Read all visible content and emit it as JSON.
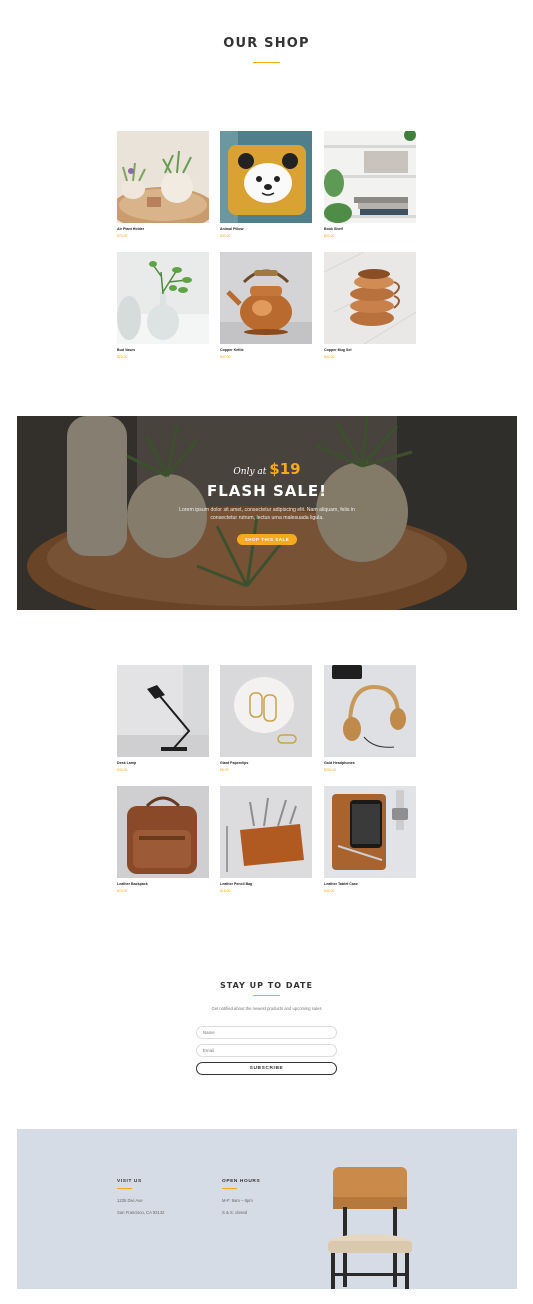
{
  "header": {
    "title": "OUR SHOP"
  },
  "products_top": [
    {
      "name": "Air Plant Holder",
      "price": "$75.00"
    },
    {
      "name": "Animal Pillow",
      "price": "$30.00"
    },
    {
      "name": "Book Shelf",
      "price": "$90.00"
    },
    {
      "name": "Bud Vases",
      "price": "$25.00"
    },
    {
      "name": "Copper Kettle",
      "price": "$47.00"
    },
    {
      "name": "Copper Mug Set",
      "price": "$40.00"
    }
  ],
  "flash_sale": {
    "only_at": "Only at",
    "price": "$19",
    "title": "FLASH SALE!",
    "text": "Lorem ipsum dolor sit amet, consectetur adipiscing elit. Nam aliquam, felis in consectetur rutrum, lectus urna malesuada ligula.",
    "button": "SHOP THIS SALE"
  },
  "products_bottom": [
    {
      "name": "Desk Lamp",
      "price": "$40.00"
    },
    {
      "name": "Giant Paperclips",
      "price": "$6.00"
    },
    {
      "name": "Gold Headphones",
      "price": "$200.00"
    },
    {
      "name": "Leather Backpack",
      "price": "$70.00"
    },
    {
      "name": "Leather Pencil Bag",
      "price": "$18.00"
    },
    {
      "name": "Leather Tablet Case",
      "price": "$40.00"
    }
  ],
  "newsletter": {
    "title": "STAY UP TO DATE",
    "subtitle": "Get notified about the newest products and upcoming sales",
    "name_placeholder": "Name",
    "email_placeholder": "Email",
    "button": "SUBSCRIBE"
  },
  "footer": {
    "visit_title": "VISIT US",
    "address_1": "1235 Divi Ave",
    "address_2": "San Francisco, CA 93132",
    "hours_title": "OPEN HOURS",
    "hours_1": "M-F: 9am – 6pm",
    "hours_2": "S & S: closed"
  },
  "colors": {
    "accent": "#f4a91f",
    "footer_bg": "#d6dce6",
    "text": "#333333"
  }
}
